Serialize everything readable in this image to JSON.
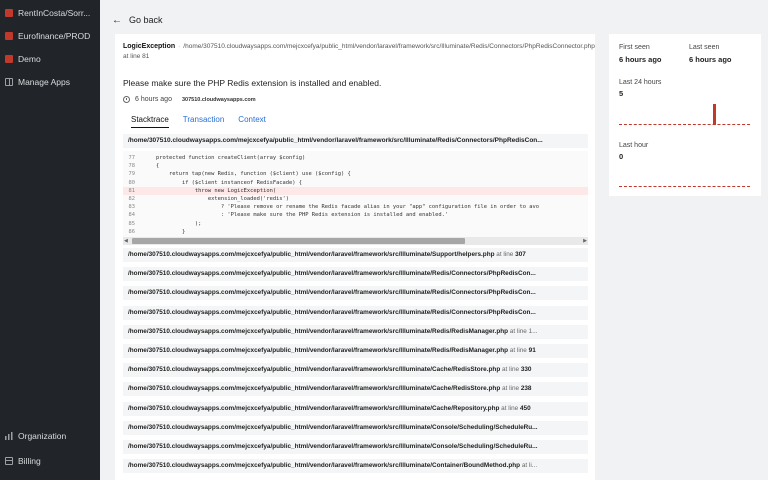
{
  "sidebar": {
    "items": [
      {
        "label": "RentInCosta/Sorr...",
        "icon": "app-icon-red"
      },
      {
        "label": "Eurofinance/PROD",
        "icon": "app-icon-red"
      },
      {
        "label": "Demo",
        "icon": "app-icon-red"
      },
      {
        "label": "Manage Apps",
        "icon": "grid-icon"
      }
    ],
    "bottom_items": [
      {
        "label": "Organization",
        "icon": "bar-chart-icon"
      },
      {
        "label": "Billing",
        "icon": "credit-card-icon"
      }
    ]
  },
  "nav": {
    "back_label": "Go back"
  },
  "exception": {
    "class_name": "LogicException",
    "path": "/home/307510.cloudwaysapps.com/mejcxcefya/public_html/vendor/laravel/framework/src/Illuminate/Redis/Connectors/PhpRedisConnector.php at line 81",
    "message": "Please make sure the PHP Redis extension is installed and enabled.",
    "time_ago": "6 hours ago",
    "host": "307510.cloudwaysapps.com"
  },
  "tabs": [
    {
      "label": "Stacktrace",
      "active": true
    },
    {
      "label": "Transaction",
      "active": false
    },
    {
      "label": "Context",
      "active": false
    }
  ],
  "stack": {
    "main_frame": "/home/307510.cloudwaysapps.com/mejcxcefya/public_html/vendor/laravel/framework/src/Illuminate/Redis/Connectors/PhpRedisCon...",
    "code": [
      {
        "n": "77",
        "text": "    protected function createClient(array $config)",
        "hl": false
      },
      {
        "n": "78",
        "text": "    {",
        "hl": false
      },
      {
        "n": "79",
        "text": "        return tap(new Redis, function ($client) use ($config) {",
        "hl": false
      },
      {
        "n": "80",
        "text": "            if ($client instanceof RedisFacade) {",
        "hl": false
      },
      {
        "n": "81",
        "text": "                throw new LogicException(",
        "hl": true
      },
      {
        "n": "82",
        "text": "                    extension_loaded('redis')",
        "hl": false
      },
      {
        "n": "83",
        "text": "                        ? 'Please remove or rename the Redis facade alias in your \"app\" configuration file in order to avo",
        "hl": false
      },
      {
        "n": "84",
        "text": "                        : 'Please make sure the PHP Redis extension is installed and enabled.'",
        "hl": false
      },
      {
        "n": "85",
        "text": "                );",
        "hl": false
      },
      {
        "n": "86",
        "text": "            }",
        "hl": false
      }
    ],
    "frames": [
      {
        "path": "/home/307510.cloudwaysapps.com/mejcxcefya/public_html/vendor/laravel/framework/src/Illuminate/Support/helpers.php",
        "suffix": " at line ",
        "line": "307"
      },
      {
        "path": "/home/307510.cloudwaysapps.com/mejcxcefya/public_html/vendor/laravel/framework/src/Illuminate/Redis/Connectors/PhpRedisCon...",
        "suffix": "",
        "line": ""
      },
      {
        "path": "/home/307510.cloudwaysapps.com/mejcxcefya/public_html/vendor/laravel/framework/src/Illuminate/Redis/Connectors/PhpRedisCon...",
        "suffix": "",
        "line": ""
      },
      {
        "path": "/home/307510.cloudwaysapps.com/mejcxcefya/public_html/vendor/laravel/framework/src/Illuminate/Redis/Connectors/PhpRedisCon...",
        "suffix": "",
        "line": ""
      },
      {
        "path": "/home/307510.cloudwaysapps.com/mejcxcefya/public_html/vendor/laravel/framework/src/Illuminate/Redis/RedisManager.php",
        "suffix": " at line 1...",
        "line": ""
      },
      {
        "path": "/home/307510.cloudwaysapps.com/mejcxcefya/public_html/vendor/laravel/framework/src/Illuminate/Redis/RedisManager.php",
        "suffix": " at line ",
        "line": "91"
      },
      {
        "path": "/home/307510.cloudwaysapps.com/mejcxcefya/public_html/vendor/laravel/framework/src/Illuminate/Cache/RedisStore.php",
        "suffix": " at line ",
        "line": "330"
      },
      {
        "path": "/home/307510.cloudwaysapps.com/mejcxcefya/public_html/vendor/laravel/framework/src/Illuminate/Cache/RedisStore.php",
        "suffix": " at line ",
        "line": "238"
      },
      {
        "path": "/home/307510.cloudwaysapps.com/mejcxcefya/public_html/vendor/laravel/framework/src/Illuminate/Cache/Repository.php",
        "suffix": " at line ",
        "line": "450"
      },
      {
        "path": "/home/307510.cloudwaysapps.com/mejcxcefya/public_html/vendor/laravel/framework/src/Illuminate/Console/Scheduling/ScheduleRu...",
        "suffix": "",
        "line": ""
      },
      {
        "path": "/home/307510.cloudwaysapps.com/mejcxcefya/public_html/vendor/laravel/framework/src/Illuminate/Console/Scheduling/ScheduleRu...",
        "suffix": "",
        "line": ""
      },
      {
        "path": "/home/307510.cloudwaysapps.com/mejcxcefya/public_html/vendor/laravel/framework/src/Illuminate/Container/BoundMethod.php",
        "suffix": " at li...",
        "line": ""
      }
    ]
  },
  "stats": {
    "first_seen_label": "First seen",
    "first_seen_value": "6 hours ago",
    "last_seen_label": "Last seen",
    "last_seen_value": "6 hours ago",
    "last24_label": "Last 24 hours",
    "last24_value": "5",
    "last_hour_label": "Last hour",
    "last_hour_value": "0"
  },
  "colors": {
    "sidebar_bg": "#212529",
    "accent_red": "#c0392b",
    "link_blue": "#2a6fd6"
  }
}
